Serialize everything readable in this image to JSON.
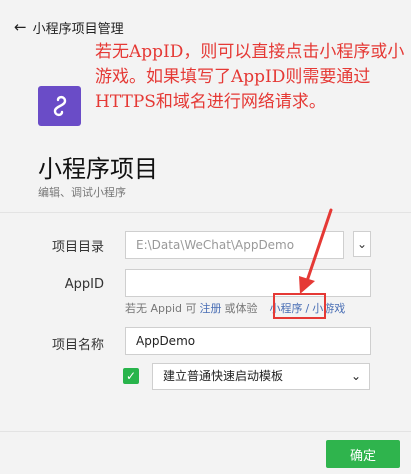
{
  "header": {
    "back_label": "小程序项目管理"
  },
  "annotation_text": "若无AppID，则可以直接点击小程序或小游戏。如果填写了AppID则需要通过HTTPS和域名进行网络请求。",
  "page": {
    "title": "小程序项目",
    "subtitle": "编辑、调试小程序"
  },
  "form": {
    "dir_label": "项目目录",
    "dir_value": "E:\\Data\\WeChat\\AppDemo",
    "appid_label": "AppID",
    "appid_value": "",
    "hint_prefix": "若无 Appid 可",
    "hint_register": "注册",
    "hint_or": "或体验",
    "hint_miniprogram": "小程序",
    "hint_sep": "/",
    "hint_minigame": "小游戏",
    "name_label": "项目名称",
    "name_value": "AppDemo",
    "template_value": "建立普通快速启动模板"
  },
  "footer": {
    "ok_label": "确定"
  },
  "colors": {
    "accent_green": "#2fb44d",
    "annotation_red": "#e53935",
    "logo_purple": "#6a4cc7",
    "link_blue": "#4a6fb5"
  }
}
